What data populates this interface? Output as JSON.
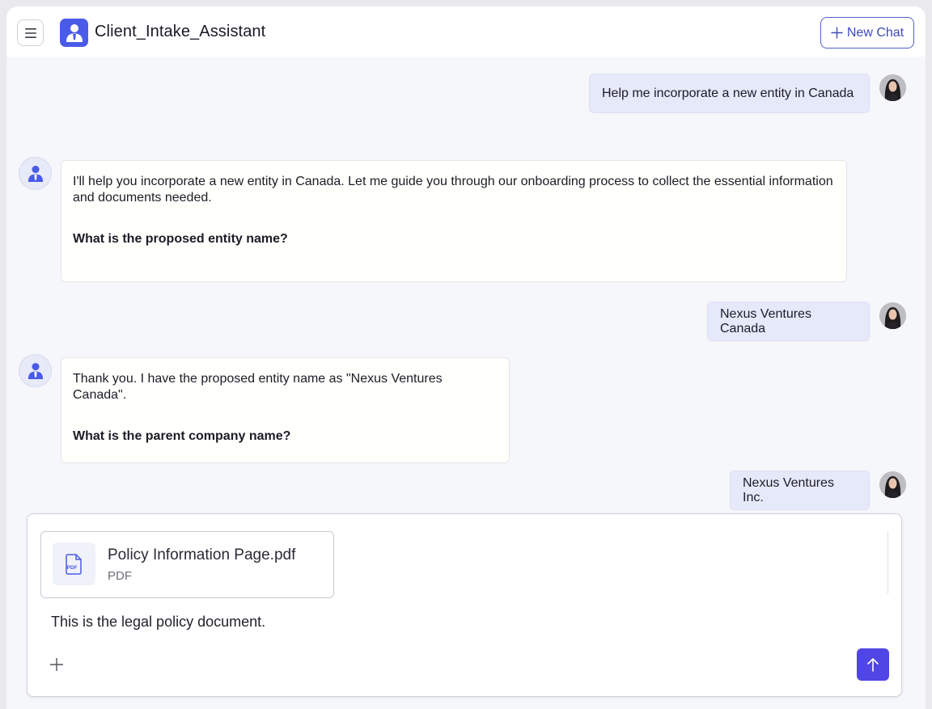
{
  "header": {
    "menu_icon": "hamburger-menu-icon",
    "logo_icon": "assistant-person-icon",
    "app_title": "Client_Intake_Assistant",
    "new_chat_label": "New Chat",
    "new_chat_icon": "plus-icon"
  },
  "messages": [
    {
      "role": "user",
      "text": "Help me incorporate a new entity in Canada"
    },
    {
      "role": "assistant",
      "text": "I'll help you incorporate a new entity in Canada. Let me guide you through our onboarding process to collect the essential information and documents needed.",
      "question": "What is the proposed entity name?"
    },
    {
      "role": "user",
      "text": "Nexus Ventures Canada"
    },
    {
      "role": "assistant",
      "text": "Thank you. I have the proposed entity name as \"Nexus Ventures Canada\".",
      "question": "What is the parent company name?"
    },
    {
      "role": "user",
      "text": "Nexus Ventures Inc."
    }
  ],
  "composer": {
    "attachment": {
      "name": "Policy Information Page.pdf",
      "type": "PDF",
      "icon": "pdf-file-icon"
    },
    "input_value": "This is the legal policy document.",
    "add_icon": "plus-icon",
    "send_icon": "arrow-up-icon"
  },
  "colors": {
    "accent": "#4a5be8",
    "send_button": "#5046e5",
    "user_bubble": "#e6e9fa",
    "assistant_bubble": "#fffffb",
    "background": "#f6f7fb"
  }
}
